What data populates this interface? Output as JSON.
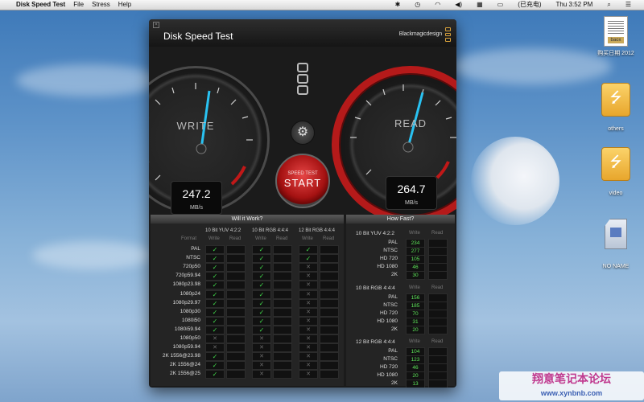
{
  "menubar": {
    "app_name": "Disk Speed Test",
    "menus": [
      "File",
      "Stress",
      "Help"
    ],
    "status_text": "(已充电)",
    "clock": "Thu 3:52 PM"
  },
  "desktop_icons": [
    {
      "label": "购买日期 2012",
      "kind": "document",
      "tag": "baox"
    },
    {
      "label": "others",
      "kind": "usb-drive"
    },
    {
      "label": "video",
      "kind": "usb-drive"
    },
    {
      "label": "NO NAME",
      "kind": "sd-card"
    }
  ],
  "window": {
    "title": "Disk Speed Test",
    "brand": "Blackmagicdesign"
  },
  "write_gauge": {
    "label": "WRITE",
    "value": "247.2",
    "unit": "MB/s"
  },
  "read_gauge": {
    "label": "READ",
    "value": "264.7",
    "unit": "MB/s"
  },
  "start_button": {
    "top": "SPEED TEST",
    "main": "START"
  },
  "will_it_work": {
    "title": "Will it Work?",
    "format_header": "Format",
    "groups": [
      "10 Bit YUV 4:2:2",
      "10 Bit RGB 4:4:4",
      "12 Bit RGB 4:4:4"
    ],
    "sub_headers": [
      "Write",
      "Read"
    ],
    "rows": [
      {
        "format": "PAL",
        "marks": [
          "ok",
          "ok",
          "ok"
        ]
      },
      {
        "format": "NTSC",
        "marks": [
          "ok",
          "ok",
          "ok"
        ]
      },
      {
        "format": "720p50",
        "marks": [
          "ok",
          "ok",
          "no"
        ]
      },
      {
        "format": "720p59.94",
        "marks": [
          "ok",
          "ok",
          "no"
        ]
      },
      {
        "format": "1080p23.98",
        "marks": [
          "ok",
          "ok",
          "no"
        ]
      },
      {
        "format": "1080p24",
        "marks": [
          "ok",
          "ok",
          "no"
        ]
      },
      {
        "format": "1080p29.97",
        "marks": [
          "ok",
          "ok",
          "no"
        ]
      },
      {
        "format": "1080p30",
        "marks": [
          "ok",
          "ok",
          "no"
        ]
      },
      {
        "format": "1080i50",
        "marks": [
          "ok",
          "ok",
          "no"
        ]
      },
      {
        "format": "1080i59.94",
        "marks": [
          "ok",
          "ok",
          "no"
        ]
      },
      {
        "format": "1080p50",
        "marks": [
          "no",
          "no",
          "no"
        ]
      },
      {
        "format": "1080p59.94",
        "marks": [
          "no",
          "no",
          "no"
        ]
      },
      {
        "format": "2K 1556@23.98",
        "marks": [
          "ok",
          "no",
          "no"
        ]
      },
      {
        "format": "2K 1556@24",
        "marks": [
          "ok",
          "no",
          "no"
        ]
      },
      {
        "format": "2K 1556@25",
        "marks": [
          "ok",
          "no",
          "no"
        ]
      }
    ]
  },
  "how_fast": {
    "title": "How Fast?",
    "sub_headers": [
      "Write",
      "Read"
    ],
    "groups": [
      {
        "name": "10 Bit YUV 4:2:2",
        "rows": [
          {
            "format": "PAL",
            "write": "234"
          },
          {
            "format": "NTSC",
            "write": "277"
          },
          {
            "format": "HD 720",
            "write": "105"
          },
          {
            "format": "HD 1080",
            "write": "46"
          },
          {
            "format": "2K",
            "write": "30"
          }
        ]
      },
      {
        "name": "10 Bit RGB 4:4:4",
        "rows": [
          {
            "format": "PAL",
            "write": "156"
          },
          {
            "format": "NTSC",
            "write": "185"
          },
          {
            "format": "HD 720",
            "write": "70"
          },
          {
            "format": "HD 1080",
            "write": "31"
          },
          {
            "format": "2K",
            "write": "20"
          }
        ]
      },
      {
        "name": "12 Bit RGB 4:4:4",
        "rows": [
          {
            "format": "PAL",
            "write": "104"
          },
          {
            "format": "NTSC",
            "write": "123"
          },
          {
            "format": "HD 720",
            "write": "46"
          },
          {
            "format": "HD 1080",
            "write": "20"
          },
          {
            "format": "2K",
            "write": "13"
          }
        ]
      }
    ]
  },
  "watermark": {
    "line1": "翔意笔记本论坛",
    "line2": "www.xynbnb.com"
  },
  "colors": {
    "accent_red": "#b51a1a",
    "ok_green": "#41d84a",
    "value_green": "#5ee65a",
    "needle": "#29c2f2"
  }
}
